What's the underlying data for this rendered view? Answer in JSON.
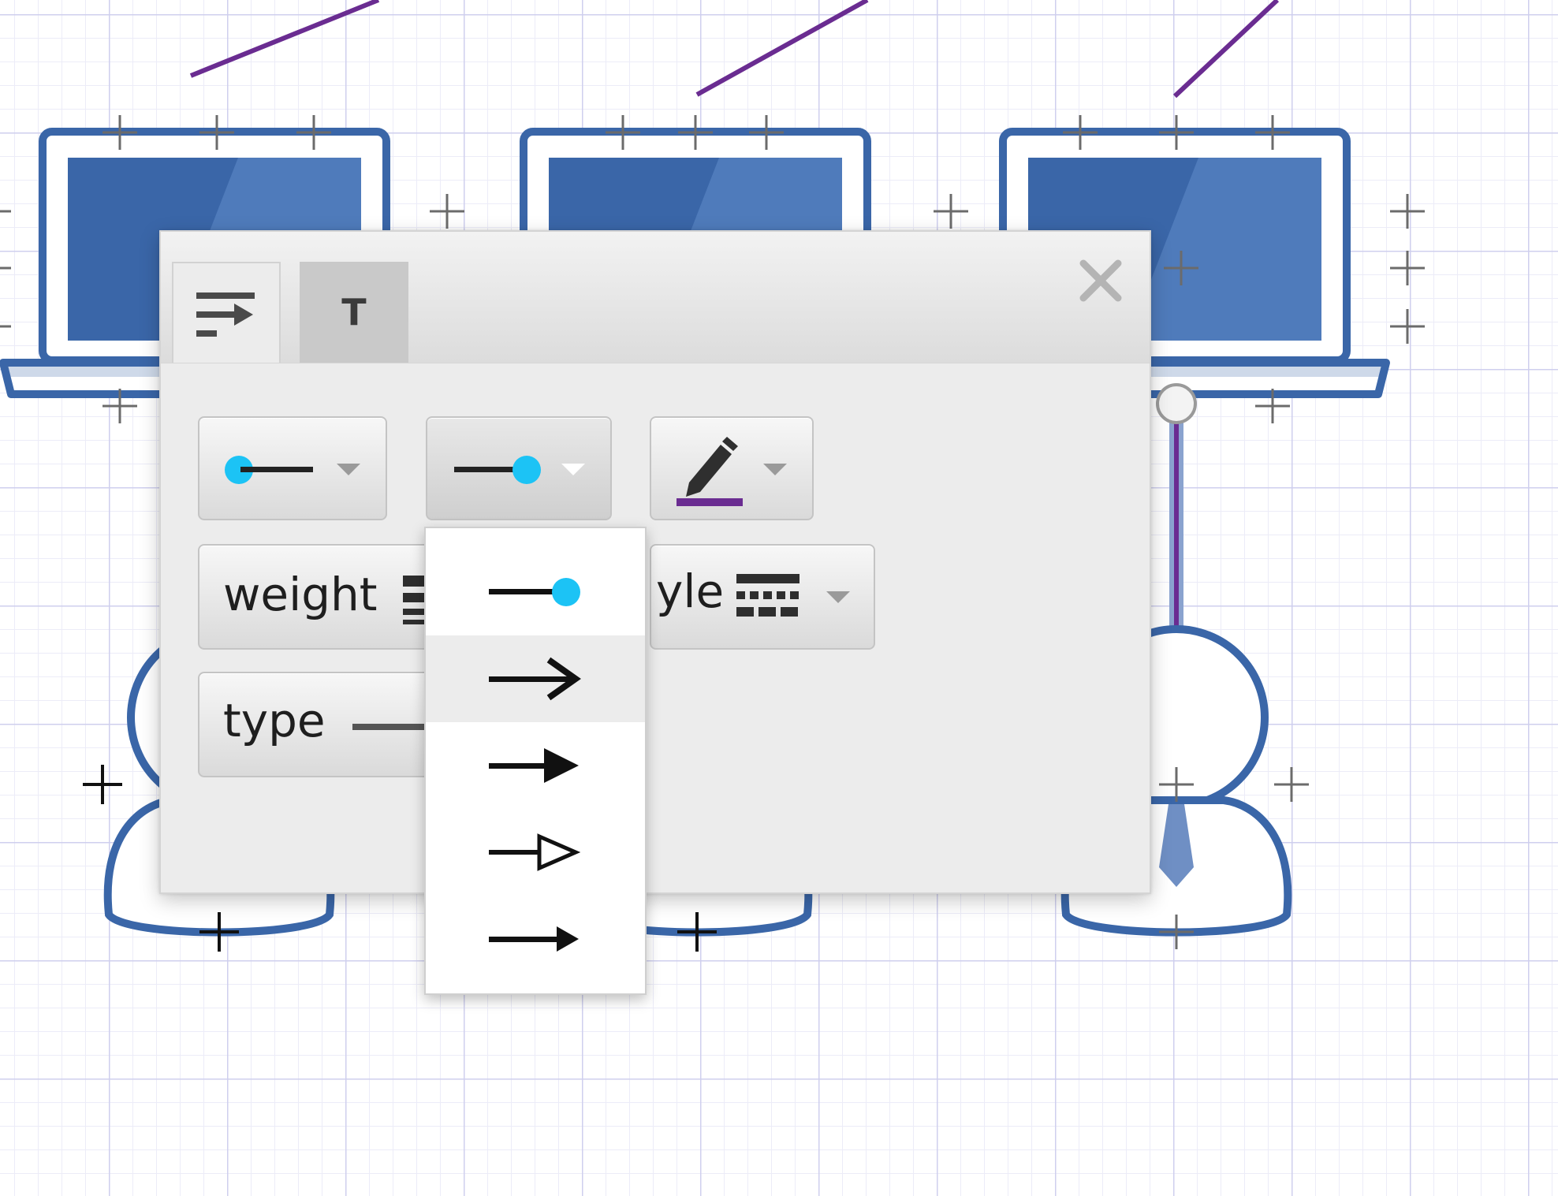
{
  "dialog": {
    "tabs": [
      {
        "name": "line-options",
        "icon": "line-arrow-icon"
      },
      {
        "name": "text-options",
        "label": "T"
      }
    ],
    "close_icon": "close-icon",
    "start_endpoint": {
      "icon": "dot-line-start-icon",
      "value": "circle"
    },
    "end_endpoint": {
      "icon": "line-dot-end-icon",
      "value": "circle"
    },
    "color_button": {
      "icon": "pencil-icon",
      "color": "#6a2c91"
    },
    "weight_button": {
      "label": "weight"
    },
    "style_button": {
      "label": "yle"
    },
    "type_button": {
      "label": "type"
    }
  },
  "end_dropdown": {
    "options": [
      {
        "name": "circle",
        "icon": "line-circle-end-icon"
      },
      {
        "name": "open-arrow",
        "icon": "open-arrow-icon",
        "highlighted": true
      },
      {
        "name": "filled-arrow",
        "icon": "filled-arrow-icon"
      },
      {
        "name": "hollow-triangle",
        "icon": "hollow-triangle-arrow-icon"
      },
      {
        "name": "small-arrow",
        "icon": "small-arrow-icon"
      }
    ]
  },
  "colors": {
    "accent_dot": "#1cc3f5",
    "connector": "#6a2c91",
    "shape_blue": "#3a66a8",
    "dialog_bg": "#ececec"
  }
}
